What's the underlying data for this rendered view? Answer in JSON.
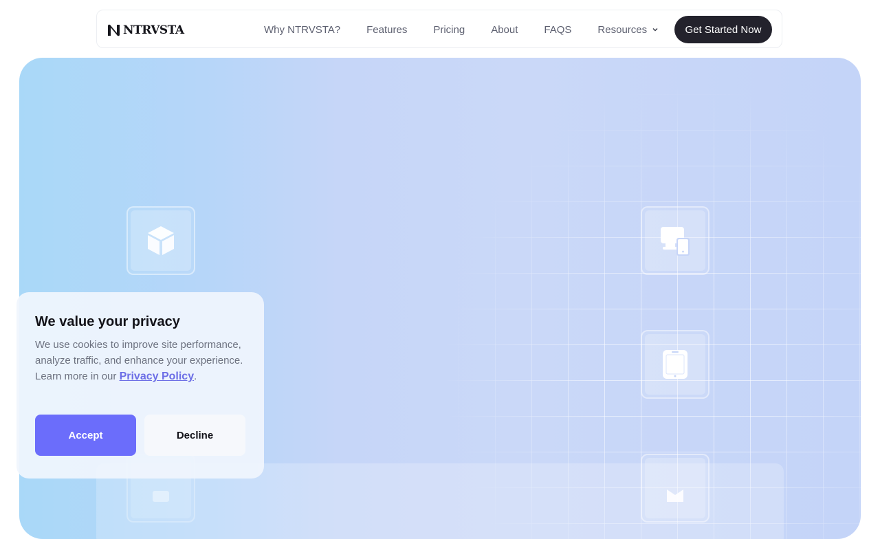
{
  "nav": {
    "brand": "NTRVSTA",
    "links": [
      "Why NTRVSTA?",
      "Features",
      "Pricing",
      "About",
      "FAQS"
    ],
    "resources_label": "Resources",
    "cta_label": "Get Started Now"
  },
  "hero": {
    "icons": [
      "cube-icon",
      "devices-icon",
      "tablet-icon",
      "partial-icon",
      "partial-icon"
    ]
  },
  "cookie": {
    "title": "We value your privacy",
    "body": "We use cookies to improve site performance, analyze traffic, and enhance your experience. Learn more in our ",
    "link_text": "Privacy Policy",
    "body_end": ".",
    "accept_label": "Accept",
    "decline_label": "Decline"
  },
  "colors": {
    "accent": "#6b6dfb",
    "cta_bg": "#23222c",
    "hero_gradient_start": "#a9d8f8",
    "hero_gradient_end": "#c4d4f8"
  }
}
